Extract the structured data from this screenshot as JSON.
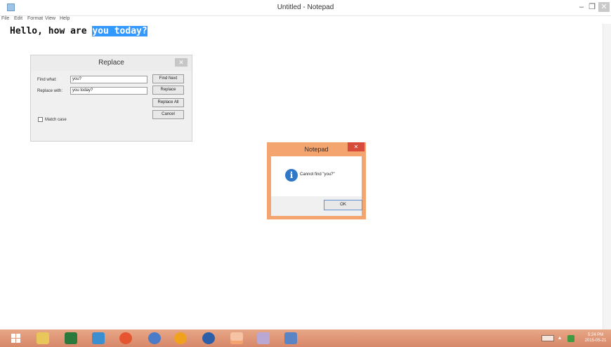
{
  "window": {
    "title": "Untitled - Notepad",
    "min_symbol": "–",
    "max_symbol": "❐",
    "close_symbol": "✕"
  },
  "menu": {
    "items": [
      "File",
      "Edit",
      "Format",
      "View",
      "Help"
    ]
  },
  "editor": {
    "text_before": "Hello, how are ",
    "text_selected": "you today?"
  },
  "replace_dialog": {
    "title": "Replace",
    "close_symbol": "✕",
    "find_label": "Find what:",
    "find_value": "you?",
    "replace_label": "Replace with:",
    "replace_value": "you today?",
    "find_next": "Find Next",
    "replace": "Replace",
    "replace_all": "Replace All",
    "cancel": "Cancel",
    "match_case": "Match case"
  },
  "message_box": {
    "title": "Notepad",
    "close_symbol": "✕",
    "icon_glyph": "i",
    "message": "Cannot find \"you?\"",
    "ok": "OK"
  },
  "taskbar": {
    "apps": [
      {
        "name": "file-explorer-icon",
        "color": "#e8c65a"
      },
      {
        "name": "word-icon",
        "color": "#2b7a3b"
      },
      {
        "name": "photo-app-icon",
        "color": "#3b8fd1"
      },
      {
        "name": "chrome-icon",
        "color": "#e5552f"
      },
      {
        "name": "messenger-icon",
        "color": "#4a7cc9"
      },
      {
        "name": "media-player-icon",
        "color": "#f0a21f"
      },
      {
        "name": "camera-app-icon",
        "color": "#2d5fa8"
      },
      {
        "name": "notepad-taskbar-icon",
        "color": "#f3a46f"
      },
      {
        "name": "paint-icon",
        "color": "#b9a8d4"
      },
      {
        "name": "window-app-icon",
        "color": "#5b84c4"
      }
    ],
    "clock_time": "5:24 PM",
    "clock_date": "2015-05-21",
    "tray_arrow": "▴"
  },
  "colors": {
    "selection": "#3399ff",
    "taskbar": "#d98b6e",
    "message_border": "#f3a46f",
    "message_close": "#d84a3a",
    "info_icon": "#2f78c8"
  }
}
